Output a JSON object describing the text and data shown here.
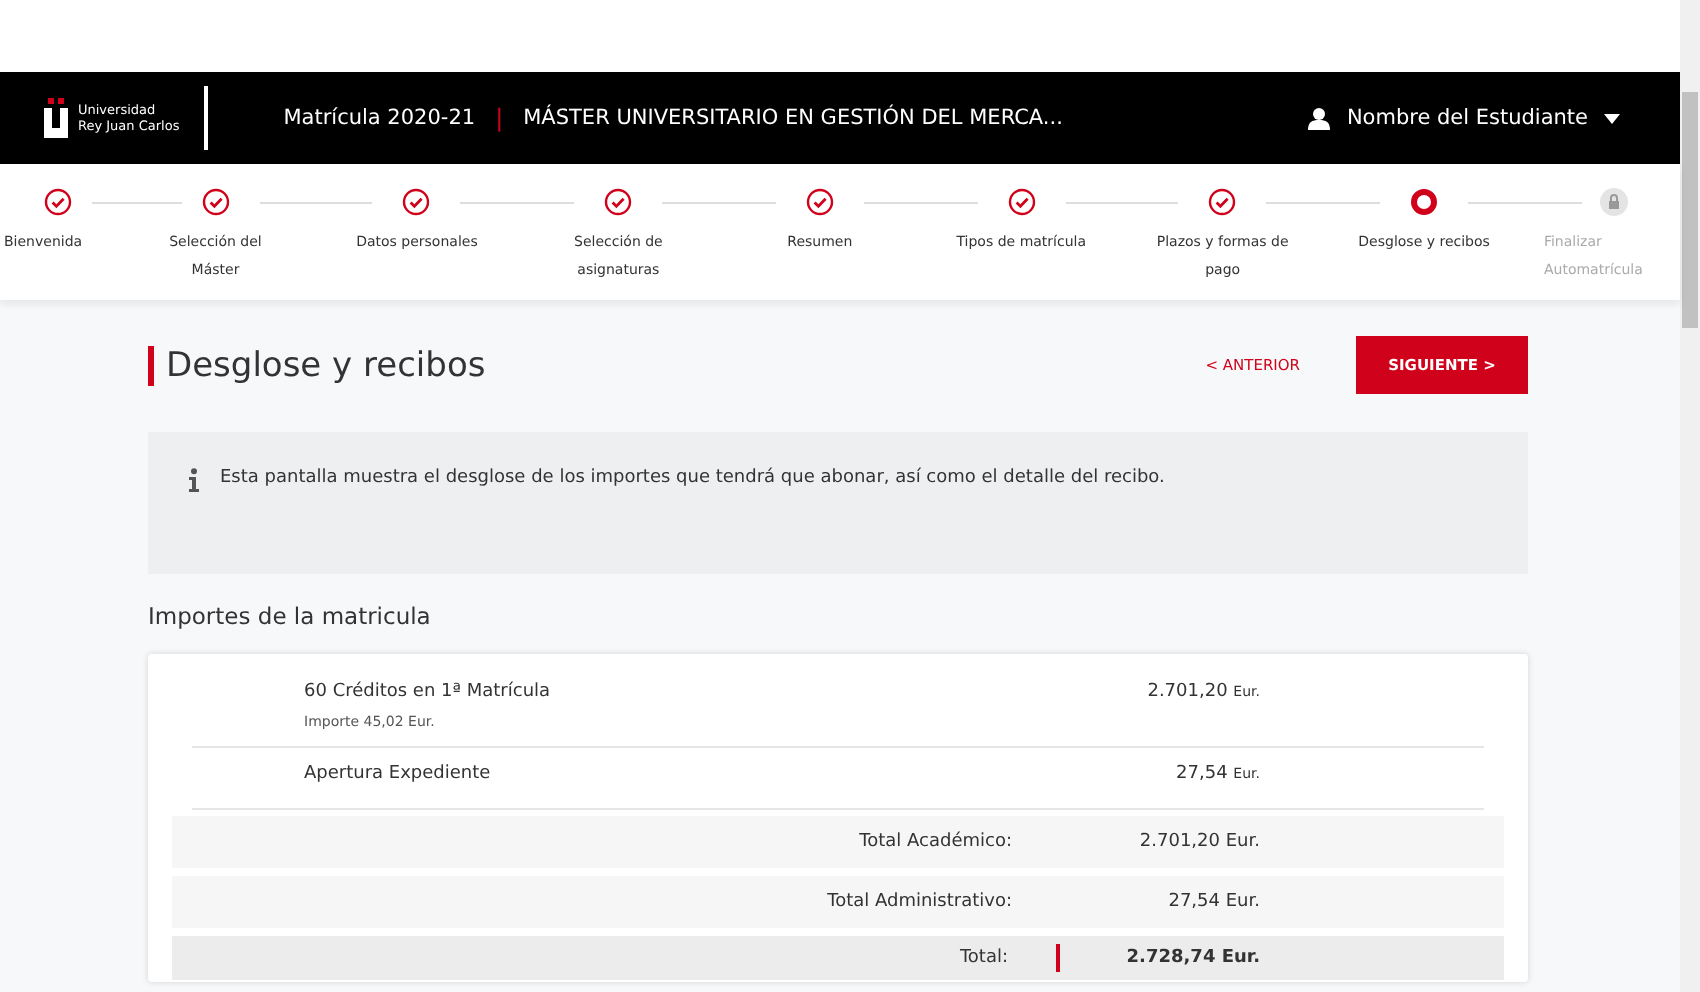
{
  "header": {
    "logo_lines": [
      "Universidad",
      "Rey Juan Carlos"
    ],
    "course": "Matrícula 2020-21",
    "separator": "|",
    "program": "MÁSTER UNIVERSITARIO EN GESTIÓN DEL MERCA...",
    "user": "Nombre del Estudiante"
  },
  "steps": [
    {
      "label": "Bienvenida",
      "selected": false,
      "locked": false
    },
    {
      "label": "Selección del Máster",
      "selected": false,
      "locked": false
    },
    {
      "label": "Datos personales",
      "selected": false,
      "locked": false
    },
    {
      "label": "Selección de asignaturas",
      "selected": false,
      "locked": false
    },
    {
      "label": "Resumen",
      "selected": false,
      "locked": false
    },
    {
      "label": "Tipos de matrícula",
      "selected": false,
      "locked": false
    },
    {
      "label": "Plazos y formas de pago",
      "selected": false,
      "locked": false
    },
    {
      "label": "Desglose y recibos",
      "selected": true,
      "locked": false
    },
    {
      "label": "Finalizar Automatrícula",
      "selected": false,
      "locked": true
    }
  ],
  "page": {
    "title": "Desglose y recibos",
    "back": "< ANTERIOR",
    "next": "SIGUIENTE >",
    "info": "Esta pantalla muestra el desglose de los importes que tendrá que abonar, así como el detalle del recibo."
  },
  "section_title": "Importes de la matricula",
  "rows": [
    {
      "kind": "item",
      "label": "60 Créditos en 1ª Matrícula",
      "detail": "Importe 45,02 Eur.",
      "amount": "2.701,20",
      "currency": "Eur."
    },
    {
      "kind": "item",
      "label": "Apertura Expediente",
      "amount": "27,54",
      "currency": "Eur."
    },
    {
      "kind": "subtotal",
      "label": "Total Académico:",
      "amount": "2.701,20",
      "currency": "Eur."
    },
    {
      "kind": "subtotal",
      "label": "Total Administrativo:",
      "amount": "27,54",
      "currency": "Eur."
    },
    {
      "kind": "total",
      "label": "Total:",
      "amount": "2.728,74",
      "currency": "Eur."
    }
  ]
}
